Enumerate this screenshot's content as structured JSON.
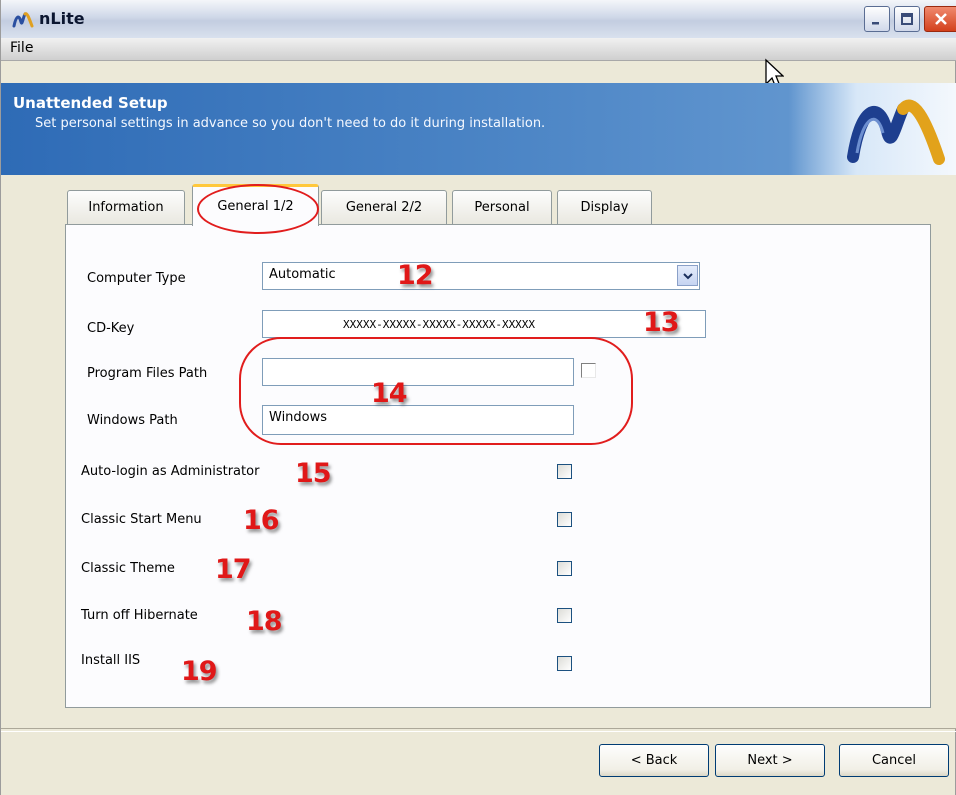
{
  "window": {
    "title": "nLite",
    "icon": "nlite-logo-icon"
  },
  "menubar": {
    "file": "File"
  },
  "header": {
    "title": "Unattended Setup",
    "subtitle": "Set personal settings in advance so you don't need to do it during installation."
  },
  "tabs": [
    {
      "label": "Information",
      "active": false
    },
    {
      "label": "General 1/2",
      "active": true
    },
    {
      "label": "General 2/2",
      "active": false
    },
    {
      "label": "Personal",
      "active": false
    },
    {
      "label": "Display",
      "active": false
    }
  ],
  "form": {
    "computer_type": {
      "label": "Computer Type",
      "value": "Automatic",
      "marker": "12"
    },
    "cd_key": {
      "label": "CD-Key",
      "value": "XXXXX-XXXXX-XXXXX-XXXXX-XXXXX",
      "marker": "13"
    },
    "program_files_path": {
      "label": "Program Files Path",
      "value": "",
      "checked": false
    },
    "windows_path": {
      "label": "Windows Path",
      "value": "Windows"
    },
    "paths_marker": "14",
    "options": [
      {
        "label": "Auto-login as Administrator",
        "marker": "15",
        "checked": false
      },
      {
        "label": "Classic Start Menu",
        "marker": "16",
        "checked": false
      },
      {
        "label": "Classic Theme",
        "marker": "17",
        "checked": false
      },
      {
        "label": "Turn off Hibernate",
        "marker": "18",
        "checked": false
      },
      {
        "label": "Install IIS",
        "marker": "19",
        "checked": false
      }
    ]
  },
  "buttons": {
    "back": "< Back",
    "next": "Next >",
    "cancel": "Cancel"
  },
  "colors": {
    "header_blue": "#2e6bb6",
    "annotation_red": "#e01818",
    "tab_highlight": "#ffc83c"
  }
}
